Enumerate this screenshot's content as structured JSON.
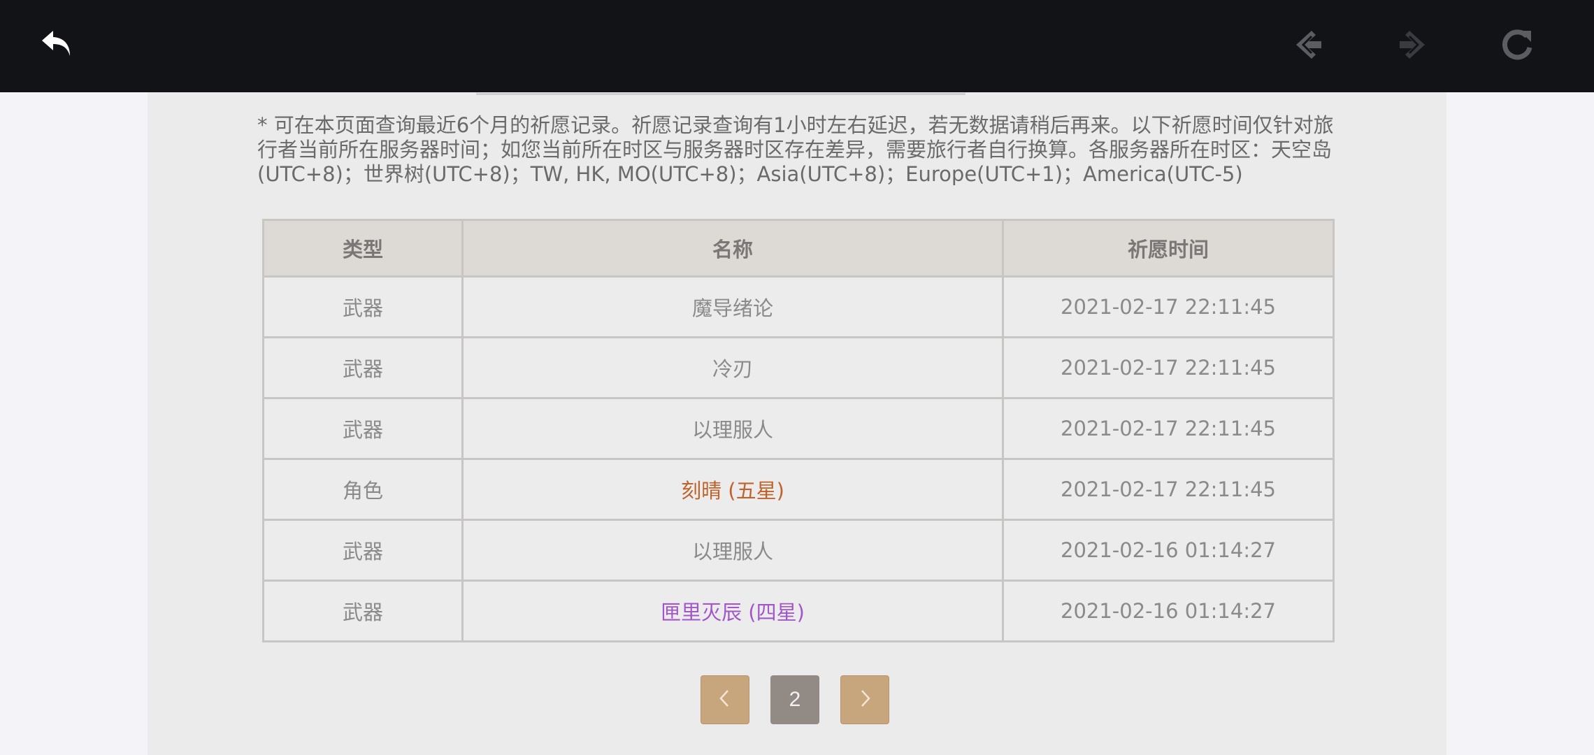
{
  "header": {
    "icons": {
      "back": "back-arrow-icon",
      "prev": "nav-back-icon",
      "next": "nav-forward-icon",
      "reload": "reload-icon"
    }
  },
  "notice": {
    "text": "* 可在本页面查询最近6个月的祈愿记录。祈愿记录查询有1小时左右延迟，若无数据请稍后再来。以下祈愿时间仅针对旅行者当前所在服务器时间；如您当前所在时区与服务器时区存在差异，需要旅行者自行换算。各服务器所在时区：天空岛(UTC+8)；世界树(UTC+8)；TW, HK, MO(UTC+8)；Asia(UTC+8)；Europe(UTC+1)；America(UTC-5)"
  },
  "table": {
    "headers": [
      "类型",
      "名称",
      "祈愿时间"
    ],
    "rows": [
      {
        "type": "武器",
        "name": "魔导绪论",
        "time": "2021-02-17 22:11:45"
      },
      {
        "type": "武器",
        "name": "冷刃",
        "time": "2021-02-17 22:11:45"
      },
      {
        "type": "武器",
        "name": "以理服人",
        "time": "2021-02-17 22:11:45"
      },
      {
        "type": "角色",
        "name": "刻晴 (五星)",
        "time": "2021-02-17 22:11:45"
      },
      {
        "type": "武器",
        "name": "以理服人",
        "time": "2021-02-16 01:14:27"
      },
      {
        "type": "武器",
        "name": "匣里灭辰 (四星)",
        "time": "2021-02-16 01:14:27"
      }
    ]
  },
  "pagination": {
    "current_page": "2",
    "prev_icon": "chevron-left-icon",
    "next_icon": "chevron-right-icon"
  },
  "colors": {
    "five_star": "#c0622a",
    "four_star": "#a257c9",
    "pager_arrow": "#c8a67d",
    "pager_current": "#928a84"
  }
}
